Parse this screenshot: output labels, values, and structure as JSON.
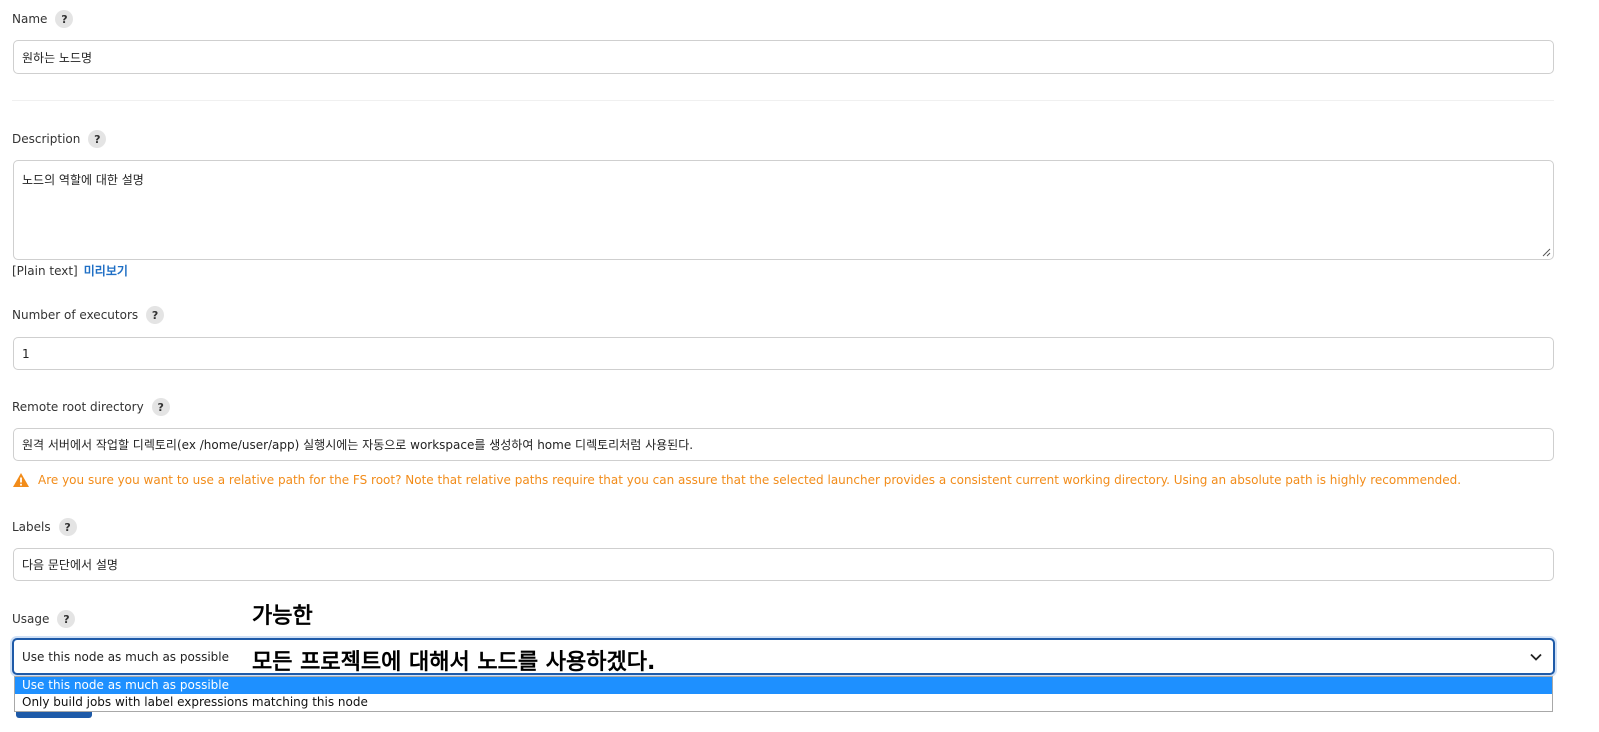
{
  "fields": {
    "name": {
      "label": "Name",
      "value": "원하는 노드명"
    },
    "description": {
      "label": "Description",
      "value": "노드의 역할에 대한 설명",
      "format_label": "[Plain text]",
      "preview_link": "미리보기"
    },
    "executors": {
      "label": "Number of executors",
      "value": "1"
    },
    "remote_root": {
      "label": "Remote root directory",
      "value": "원격 서버에서 작업할 디렉토리(ex /home/user/app) 실행시에는 자동으로 workspace를 생성하여 home 디렉토리처럼 사용된다.",
      "warning": "Are you sure you want to use a relative path for the FS root? Note that relative paths require that you can assure that the selected launcher provides a consistent current working directory. Using an absolute path is highly recommended."
    },
    "labels": {
      "label": "Labels",
      "value": "다음 문단에서 설명"
    },
    "usage": {
      "label": "Usage",
      "selected": "Use this node as much as possible",
      "options": [
        "Use this node as much as possible",
        "Only build jobs with label expressions matching this node"
      ]
    }
  },
  "help_glyph": "?",
  "annotation": {
    "line1": "가능한",
    "line2": "모든 프로젝트에 대해서 노드를 사용하겠다."
  },
  "colors": {
    "warning": "#f28c1a",
    "link": "#1f6fc5",
    "focus_border": "#1e5aa8",
    "option_highlight": "#1e90ff"
  }
}
